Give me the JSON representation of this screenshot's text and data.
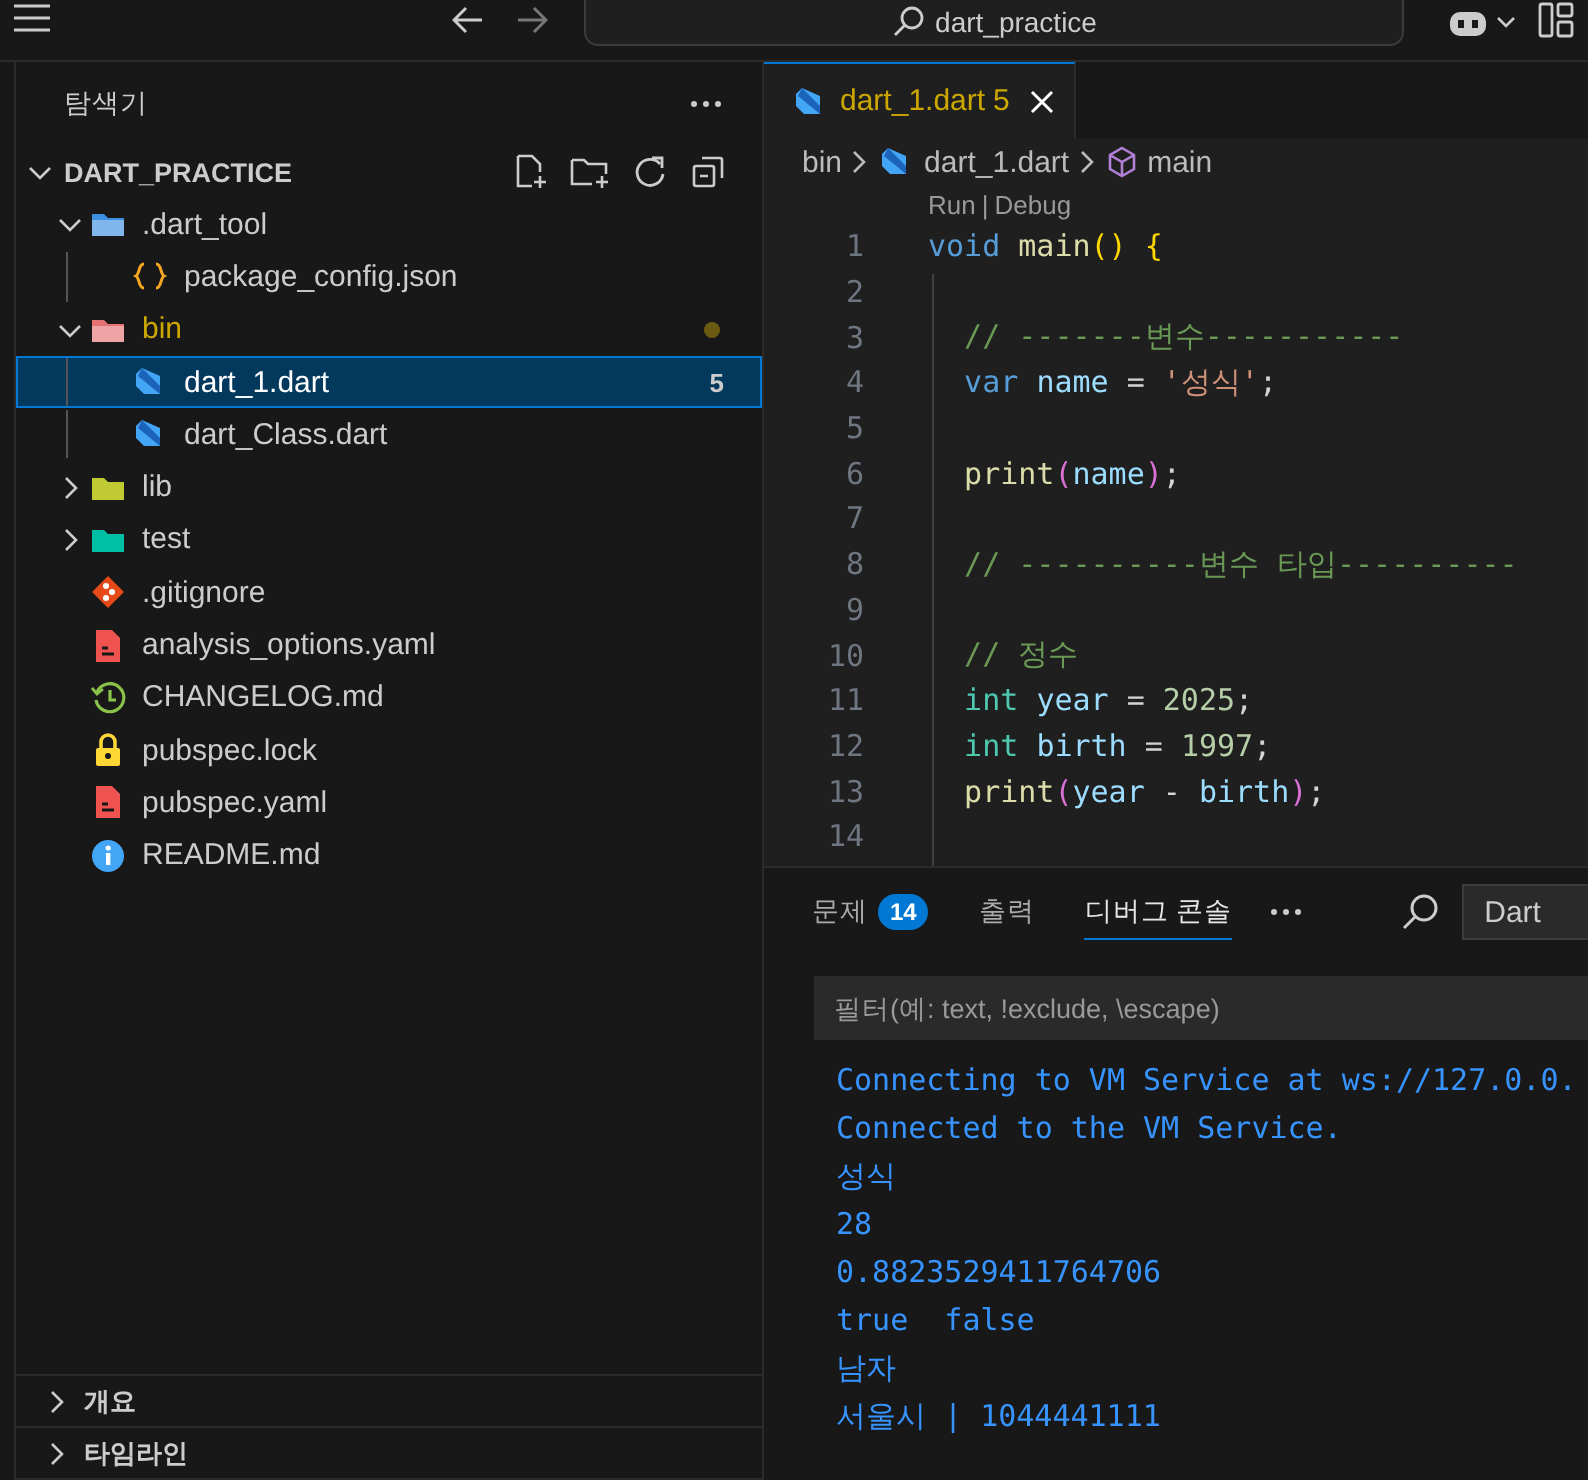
{
  "title_bar": {
    "search": "dart_practice"
  },
  "explorer": {
    "title": "탐색기",
    "root": {
      "label": "DART_PRACTICE",
      "expanded": true
    },
    "tree": [
      {
        "label": ".dart_tool",
        "kind": "folder-tool",
        "expanded": true,
        "selected": false,
        "children": [
          {
            "label": "package_config.json",
            "kind": "json",
            "selected": false
          }
        ]
      },
      {
        "label": "bin",
        "kind": "folder-bin",
        "expanded": true,
        "selected": false,
        "warning": true,
        "children": [
          {
            "label": "dart_1.dart",
            "kind": "dart",
            "selected": true,
            "badge": "5"
          },
          {
            "label": "dart_Class.dart",
            "kind": "dart",
            "selected": false
          }
        ]
      },
      {
        "label": "lib",
        "kind": "folder-lib",
        "expanded": false,
        "selected": false
      },
      {
        "label": "test",
        "kind": "folder-test",
        "expanded": false,
        "selected": false
      },
      {
        "label": ".gitignore",
        "kind": "git",
        "selected": false
      },
      {
        "label": "analysis_options.yaml",
        "kind": "yaml",
        "selected": false
      },
      {
        "label": "CHANGELOG.md",
        "kind": "changelog",
        "selected": false
      },
      {
        "label": "pubspec.lock",
        "kind": "lock",
        "selected": false
      },
      {
        "label": "pubspec.yaml",
        "kind": "yaml",
        "selected": false
      },
      {
        "label": "README.md",
        "kind": "info",
        "selected": false
      }
    ],
    "sections": [
      {
        "label": "개요",
        "expanded": false
      },
      {
        "label": "타임라인",
        "expanded": false
      }
    ]
  },
  "editor": {
    "tabs": [
      {
        "label": "dart_1.dart",
        "badge": "5",
        "selected": true
      }
    ],
    "breadcrumbs": [
      {
        "label": "bin",
        "kind": "folder"
      },
      {
        "label": "dart_1.dart",
        "kind": "dart"
      },
      {
        "label": "main",
        "kind": "symbol"
      }
    ],
    "codelens": {
      "items": [
        "Run",
        "Debug"
      ],
      "separator": "|"
    },
    "lines": [
      {
        "number": "1",
        "tokens": [
          {
            "text": "void ",
            "kind": "keyword"
          },
          {
            "text": "main",
            "kind": "func"
          },
          {
            "text": "() {",
            "kind": "bracket1"
          }
        ]
      },
      {
        "number": "2"
      },
      {
        "number": "3",
        "tokens": [
          {
            "text": "  // -------변수-----------",
            "kind": "comment"
          }
        ]
      },
      {
        "number": "4",
        "tokens": [
          {
            "text": "  var ",
            "kind": "keyword"
          },
          {
            "text": "name",
            "kind": "var"
          },
          {
            "text": " = ",
            "kind": "punct"
          },
          {
            "text": "'성식'",
            "kind": "string"
          },
          {
            "text": ";",
            "kind": "punct"
          }
        ]
      },
      {
        "number": "5"
      },
      {
        "number": "6",
        "tokens": [
          {
            "text": "  print",
            "kind": "func"
          },
          {
            "text": "(",
            "kind": "bracket2"
          },
          {
            "text": "name",
            "kind": "var"
          },
          {
            "text": ")",
            "kind": "bracket2"
          },
          {
            "text": ";",
            "kind": "punct"
          }
        ]
      },
      {
        "number": "7"
      },
      {
        "number": "8",
        "tokens": [
          {
            "text": "  // ----------변수 타입----------",
            "kind": "comment"
          }
        ]
      },
      {
        "number": "9"
      },
      {
        "number": "10",
        "tokens": [
          {
            "text": "  // 정수",
            "kind": "comment"
          }
        ]
      },
      {
        "number": "11",
        "tokens": [
          {
            "text": "  int ",
            "kind": "type"
          },
          {
            "text": "year",
            "kind": "var"
          },
          {
            "text": " = ",
            "kind": "punct"
          },
          {
            "text": "2025",
            "kind": "number"
          },
          {
            "text": ";",
            "kind": "punct"
          }
        ]
      },
      {
        "number": "12",
        "tokens": [
          {
            "text": "  int ",
            "kind": "type"
          },
          {
            "text": "birth",
            "kind": "var"
          },
          {
            "text": " = ",
            "kind": "punct"
          },
          {
            "text": "1997",
            "kind": "number"
          },
          {
            "text": ";",
            "kind": "punct"
          }
        ]
      },
      {
        "number": "13",
        "tokens": [
          {
            "text": "  print",
            "kind": "func"
          },
          {
            "text": "(",
            "kind": "bracket2"
          },
          {
            "text": "year",
            "kind": "var"
          },
          {
            "text": " - ",
            "kind": "punct"
          },
          {
            "text": "birth",
            "kind": "var"
          },
          {
            "text": ")",
            "kind": "bracket2"
          },
          {
            "text": ";",
            "kind": "punct"
          }
        ]
      },
      {
        "number": "14"
      }
    ]
  },
  "panel": {
    "tabs": [
      {
        "label": "문제",
        "badge": "14",
        "selected": false
      },
      {
        "label": "출력",
        "selected": false
      },
      {
        "label": "디버그 콘솔",
        "selected": true
      }
    ],
    "filter_value": "Dart",
    "filter": {
      "placeholder": "필터(예: text, !exclude, \\escape)"
    },
    "console": [
      "Connecting to VM Service at ws://127.0.0.",
      "Connected to the VM Service.",
      "성식",
      "28",
      "0.8823529411764706",
      "true  false",
      "남자",
      "서울시 | 1044441111"
    ]
  }
}
